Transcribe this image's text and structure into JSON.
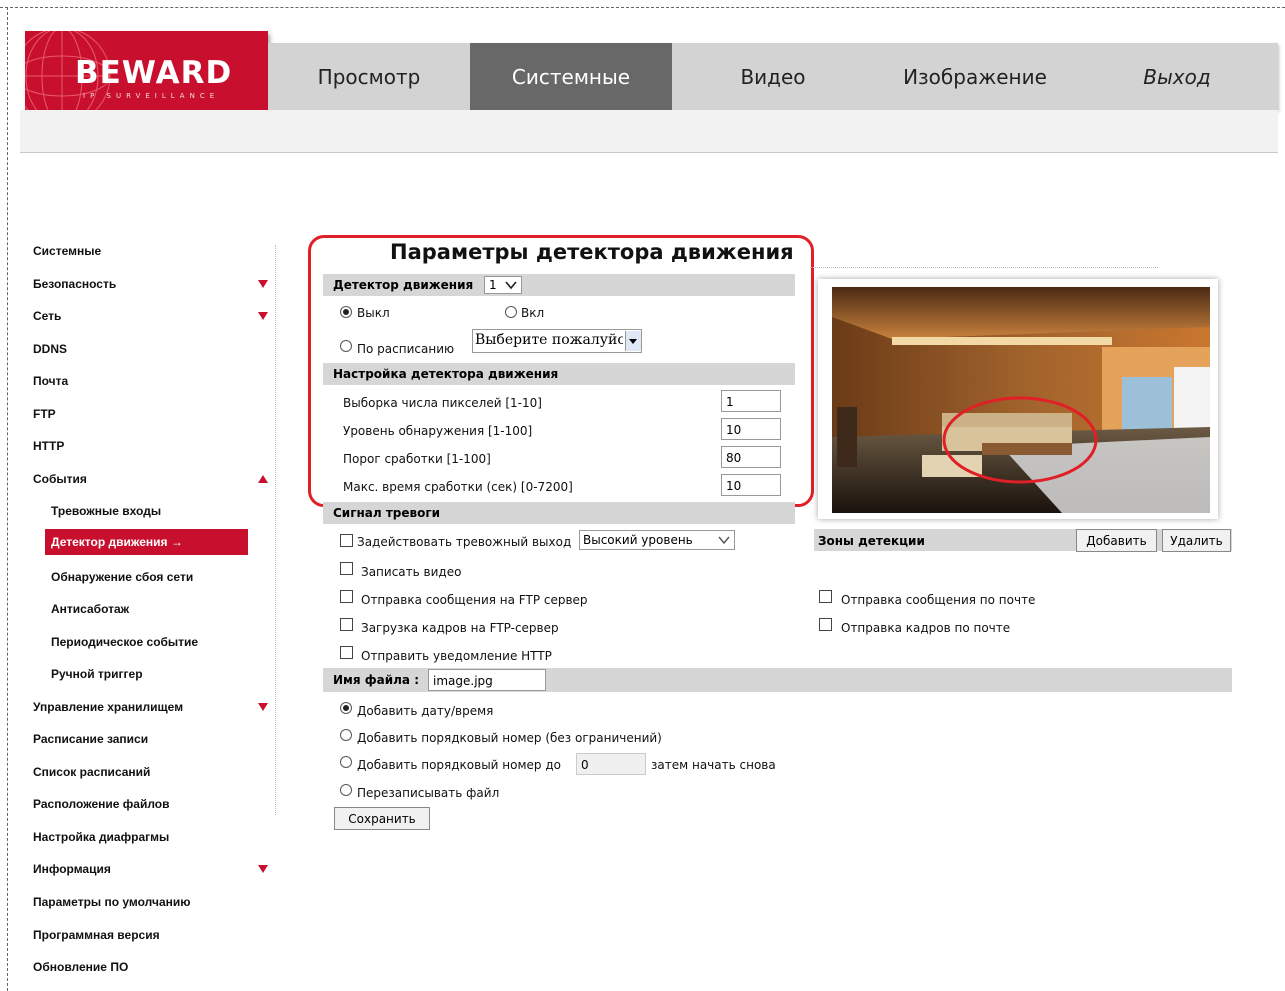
{
  "header": {
    "brand": "BEWARD",
    "brand_sub": "IP SURVEILLANCE",
    "tabs": [
      "Просмотр",
      "Системные",
      "Видео",
      "Изображение",
      "Выход"
    ],
    "active_tab": "Системные"
  },
  "sidebar": {
    "items": [
      {
        "label": "Системные"
      },
      {
        "label": "Безопасность",
        "arrow": "down"
      },
      {
        "label": "Сеть",
        "arrow": "down"
      },
      {
        "label": "DDNS"
      },
      {
        "label": "Почта"
      },
      {
        "label": "FTP"
      },
      {
        "label": "HTTP"
      },
      {
        "label": "События",
        "arrow": "up"
      },
      {
        "label": "Тревожные входы",
        "sub": true
      },
      {
        "label": "Детектор движения →",
        "sub": true,
        "active": true
      },
      {
        "label": "Обнаружение сбоя сети",
        "sub": true
      },
      {
        "label": "Антисаботаж",
        "sub": true
      },
      {
        "label": "Периодическое событие",
        "sub": true
      },
      {
        "label": "Ручной триггер",
        "sub": true
      },
      {
        "label": "Управление хранилищем",
        "arrow": "down"
      },
      {
        "label": "Расписание записи"
      },
      {
        "label": "Список расписаний"
      },
      {
        "label": "Расположение файлов"
      },
      {
        "label": "Настройка диафрагмы"
      },
      {
        "label": "Информация",
        "arrow": "down"
      },
      {
        "label": "Параметры по умолчанию"
      },
      {
        "label": "Программная версия"
      },
      {
        "label": "Обновление ПО"
      }
    ]
  },
  "panel": {
    "title": "Параметры детектора движения",
    "detector_label": "Детектор движения",
    "detector_select": "1",
    "off_label": "Выкл",
    "on_label": "Вкл",
    "schedule_label": "По расписанию",
    "schedule_select": "Выберите пожалуйст",
    "settings_header": "Настройка детектора движения",
    "params": [
      {
        "label": "Выборка числа пикселей [1-10]",
        "value": "1"
      },
      {
        "label": "Уровень обнаружения [1-100]",
        "value": "10"
      },
      {
        "label": "Порог сработки [1-100]",
        "value": "80"
      },
      {
        "label": "Макс. время сработки (сек) [0-7200]",
        "value": "10"
      }
    ],
    "alarm_header": "Сигнал тревоги",
    "alarm_out_label": "Задействовать тревожный выход",
    "alarm_level": "Высокий уровень",
    "record_video": "Записать видео",
    "ftp_message": "Отправка сообщения на FTP сервер",
    "ftp_upload": "Загрузка кадров на FTP-сервер",
    "http_notify": "Отправить уведомление HTTP",
    "mail_message": "Отправка сообщения по почте",
    "mail_frames": "Отправка кадров по почте",
    "zones_label": "Зоны детекции",
    "add_button": "Добавить",
    "delete_button": "Удалить",
    "filename_label": "Имя файла :",
    "filename_value": "image.jpg",
    "opt_datetime": "Добавить дату/время",
    "opt_seq_unlimited": "Добавить порядковый номер (без ограничений)",
    "opt_seq_upto": "Добавить порядковый номер до",
    "seq_value": "0",
    "restart_label": "затем начать снова",
    "opt_overwrite": "Перезаписывать файл",
    "save_button": "Сохранить"
  },
  "colors": {
    "accent": "#c8102e",
    "tab_active": "#686868",
    "tab_bg": "#d3d3d3",
    "highlight_box": "#e01f26"
  }
}
